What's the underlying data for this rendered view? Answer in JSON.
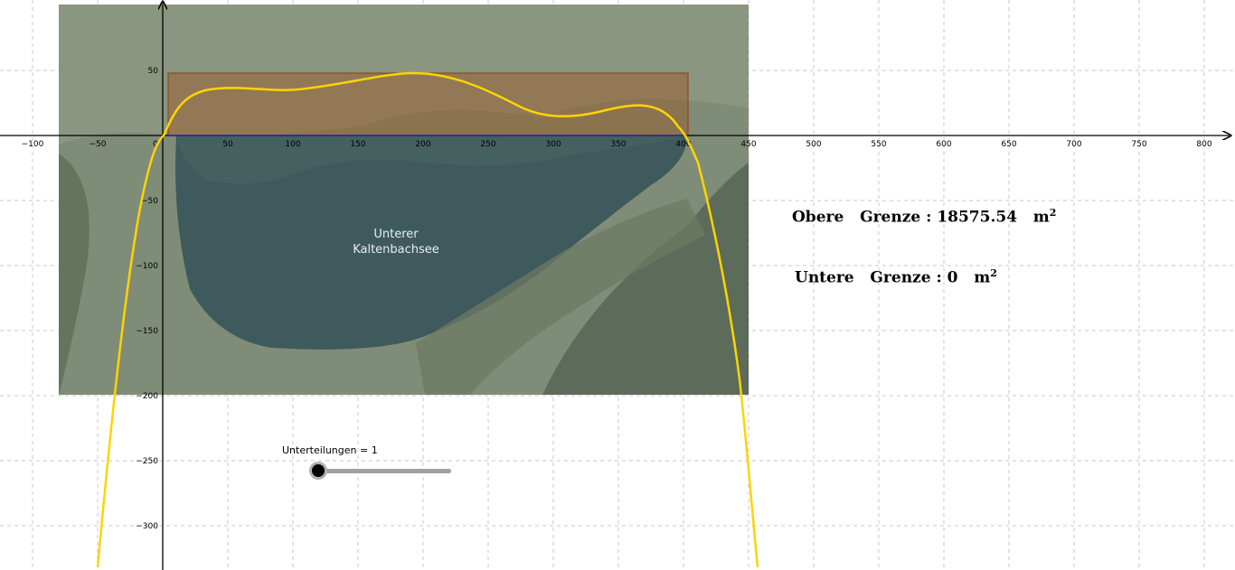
{
  "axes": {
    "x_ticks": [
      "−100",
      "−50",
      "0",
      "50",
      "100",
      "150",
      "200",
      "250",
      "300",
      "350",
      "400",
      "450",
      "500",
      "550",
      "600",
      "650",
      "700",
      "750",
      "800"
    ],
    "y_ticks": [
      "50",
      "−50",
      "−100",
      "−150",
      "−200",
      "−250",
      "−300"
    ],
    "grid": true
  },
  "map_image": {
    "lake_label_line1": "Unterer",
    "lake_label_line2": "Kaltenbachsee"
  },
  "results": {
    "upper_label": "Obere",
    "upper_word": "Grenze",
    "upper_value": "18575.54",
    "lower_label": "Untere",
    "lower_word": "Grenze",
    "lower_value": "0",
    "unit": "m",
    "unit_exp": "2"
  },
  "slider": {
    "label": "Unterteilungen = 1",
    "value": 1
  },
  "colors": {
    "curve": "#ffd400",
    "rectangle_fill": "#9a5a2a",
    "rectangle_stroke": "#8a4a1a",
    "x_axis_segment": "#2020c0"
  }
}
